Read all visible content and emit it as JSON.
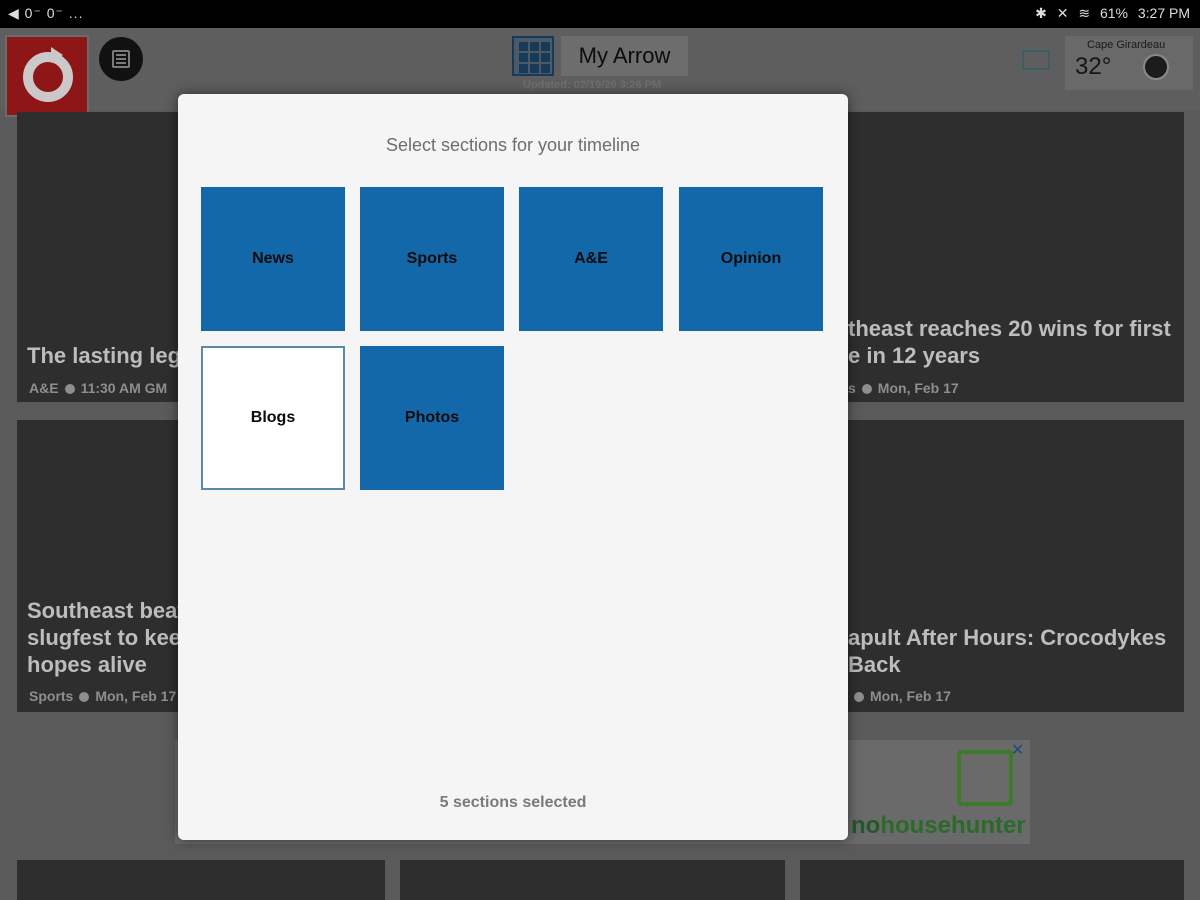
{
  "status_bar": {
    "left_icons": "◀ 0⁻ 0⁻ ...",
    "battery": "61%",
    "time": "3:27 PM"
  },
  "header": {
    "title": "My Arrow",
    "updated": "Updated: 02/19/20 3:26 PM",
    "weather": {
      "city": "Cape Girardeau",
      "temp": "32°"
    }
  },
  "cards": [
    {
      "headline": "The lasting leg",
      "section": "A&E",
      "time": "11:30 AM GM"
    },
    {
      "headline": "theast reaches 20 wins for first\ne in 12 years",
      "section": "s",
      "time": "Mon, Feb 17"
    },
    {
      "headline": "Southeast beat\nslugfest to kee\nhopes alive",
      "section": "Sports",
      "time": "Mon, Feb 17"
    },
    {
      "headline": "apult After Hours: Crocodykes\nBack",
      "section": "",
      "time": "Mon, Feb 17"
    }
  ],
  "ad": {
    "brand_a": "no",
    "brand_b": "househunter",
    "close": "✕"
  },
  "dialog": {
    "heading": "Select sections for your timeline",
    "sections": [
      {
        "label": "News",
        "selected": true
      },
      {
        "label": "Sports",
        "selected": true
      },
      {
        "label": "A&E",
        "selected": true
      },
      {
        "label": "Opinion",
        "selected": true
      },
      {
        "label": "Blogs",
        "selected": false
      },
      {
        "label": "Photos",
        "selected": true
      }
    ],
    "count_text": "5 sections selected"
  },
  "colors": {
    "selected_tile": "#1368aa",
    "unselected_tile": "#ffffff",
    "dialog_bg": "#f5f5f5"
  }
}
